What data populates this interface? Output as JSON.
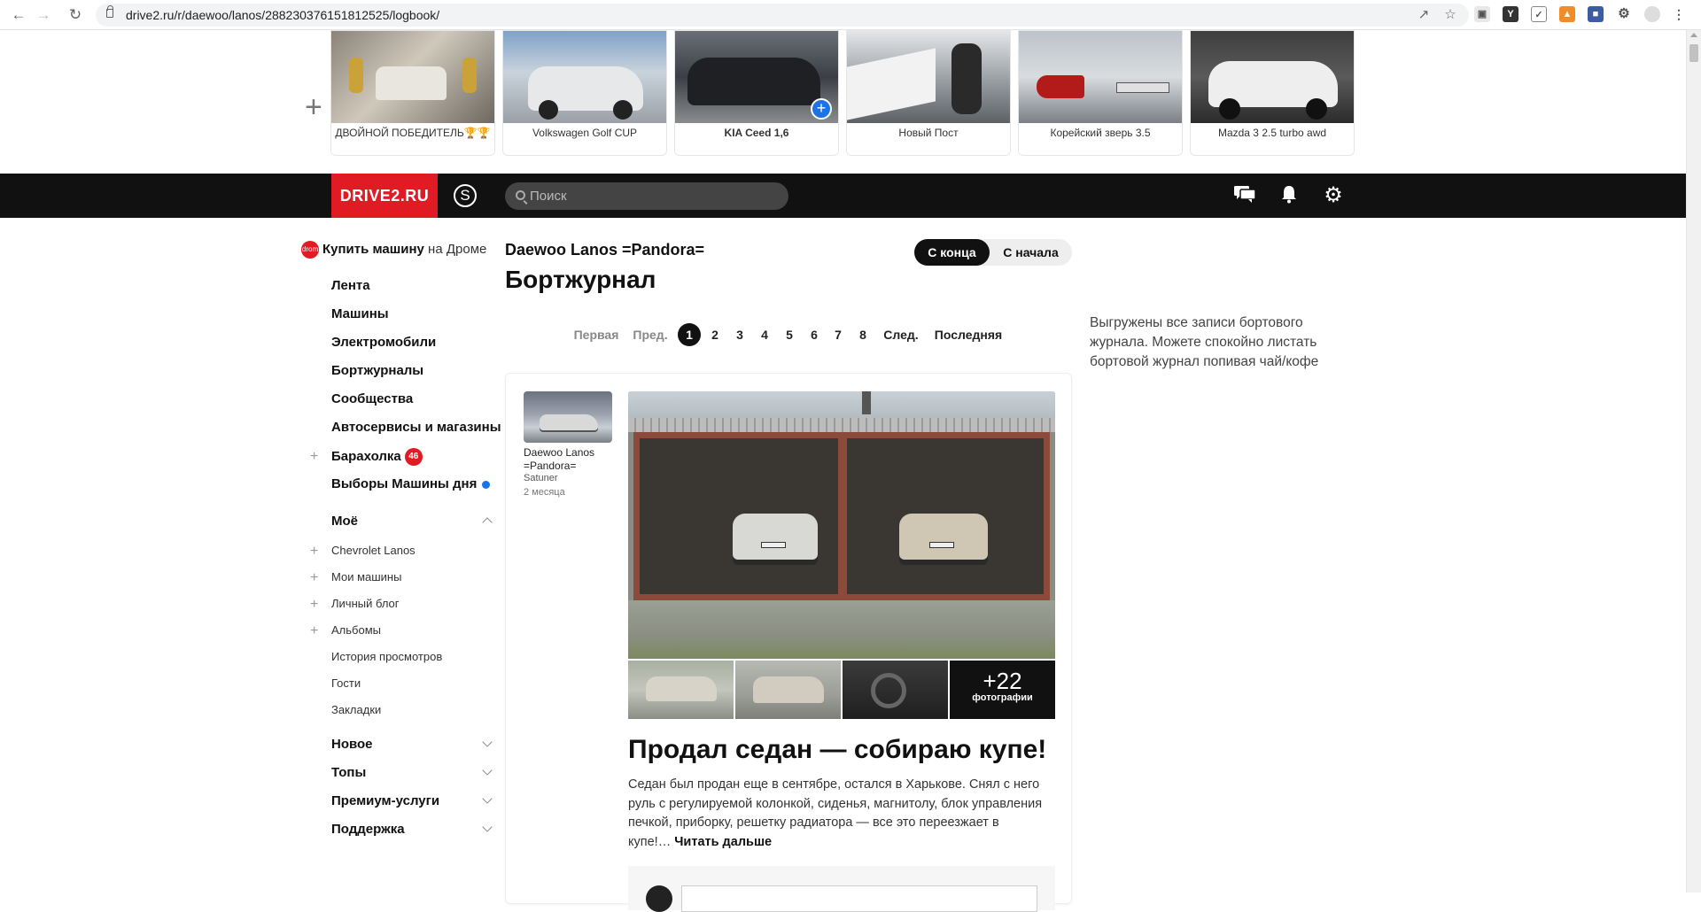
{
  "browser": {
    "url": "drive2.ru/r/daewoo/lanos/288230376151812525/logbook/"
  },
  "stories": {
    "items": [
      {
        "caption": "ДВОЙНОЙ ПОБЕДИТЕЛЬ🏆🏆",
        "colors": [
          "#8b8378",
          "#d8d3c8"
        ]
      },
      {
        "caption": "Volkswagen Golf CUP",
        "colors": [
          "#6d8fb8",
          "#d8dce0"
        ]
      },
      {
        "caption": "KIA Ceed 1,6",
        "colors": [
          "#5a5f66",
          "#2a2d33"
        ]
      },
      {
        "caption": "Новый Пост",
        "colors": [
          "#cfd3d6",
          "#7a7f85"
        ]
      },
      {
        "caption": "Корейский зверь 3.5",
        "colors": [
          "#9aa4ad",
          "#c8ccd0"
        ]
      },
      {
        "caption": "Mazda 3 2.5 turbo awd",
        "colors": [
          "#3a3a3a",
          "#e6e6e6"
        ]
      }
    ]
  },
  "header": {
    "logo": "DRIVE2.RU",
    "user_initial": "S",
    "search_placeholder": "Поиск"
  },
  "sidebar": {
    "buy_car_bold": "Купить машину",
    "buy_car_rest": " на Дроме",
    "items": [
      {
        "label": "Лента"
      },
      {
        "label": "Машины"
      },
      {
        "label": "Электромобили"
      },
      {
        "label": "Бортжурналы"
      },
      {
        "label": "Сообщества"
      },
      {
        "label": "Автосервисы и магазины"
      },
      {
        "label": "Барахолка",
        "badge": "46"
      },
      {
        "label": "Выборы Машины дня"
      }
    ],
    "mine_title": "Моё",
    "mine_items": [
      {
        "label": "Chevrolet Lanos"
      },
      {
        "label": "Мои машины"
      },
      {
        "label": "Личный блог"
      },
      {
        "label": "Альбомы"
      },
      {
        "label": "История просмотров"
      },
      {
        "label": "Гости"
      },
      {
        "label": "Закладки"
      }
    ],
    "groups": [
      {
        "label": "Новое"
      },
      {
        "label": "Топы"
      },
      {
        "label": "Премиум-услуги"
      },
      {
        "label": "Поддержка"
      }
    ]
  },
  "main": {
    "car_name": "Daewoo Lanos =Pandora=",
    "page_title": "Бортжурнал",
    "order": {
      "active": "С конца",
      "inactive": "С начала"
    },
    "pager": {
      "first": "Первая",
      "prev": "Пред.",
      "pages": [
        "1",
        "2",
        "3",
        "4",
        "5",
        "6",
        "7",
        "8"
      ],
      "current": "1",
      "next": "След.",
      "last": "Последняя"
    }
  },
  "post": {
    "author_car": "Daewoo Lanos =Pandora=",
    "author_user": "Satuner",
    "age": "2 месяца",
    "more_count": "+22",
    "more_label": "фотографии",
    "title": "Продал седан — собираю купе!",
    "text": "Седан был продан еще в сентябре, остался в Харькове. Снял с него руль с регулируемой колонкой, сиденья, магнитолу, блок управления печкой, приборку, решетку радиатора — все это переезжает в купе!…",
    "read_more": "Читать дальше"
  },
  "right_note": "Выгружены все записи бортового журнала. Можете спокойно листать бортовой журнал попивая чай/кофе",
  "colors": {
    "brand": "#e01b23",
    "accent_blue": "#1a73e8"
  }
}
